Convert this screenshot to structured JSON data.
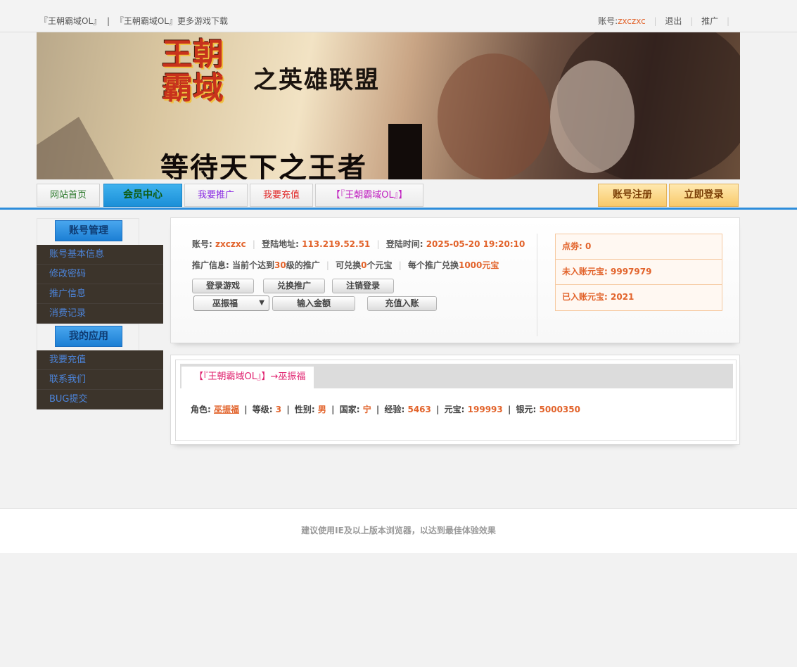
{
  "topbar": {
    "links": [
      "『王朝霸域OL』",
      "|",
      "『王朝霸域OL』更多游戏下载"
    ],
    "account_label": "账号:",
    "account_value": "zxczxc",
    "logout": "退出",
    "promote": "推广"
  },
  "banner": {
    "logo": "王朝霸域",
    "slogan": "之英雄联盟",
    "tagline": "等待天下之王者"
  },
  "nav": {
    "home": "网站首页",
    "member": "会员中心",
    "promote": "我要推广",
    "recharge": "我要充值",
    "game": "【『王朝霸域OL』】",
    "register": "账号注册",
    "login": "立即登录"
  },
  "sidebar": {
    "account_title": "账号管理",
    "account_items": [
      "账号基本信息",
      "修改密码",
      "推广信息",
      "消费记录"
    ],
    "apps_title": "我的应用",
    "app_items": [
      "我要充值",
      "联系我们",
      "BUG提交"
    ]
  },
  "account_panel": {
    "account_label": "账号:",
    "account_value": "zxczxc",
    "ip_label": "登陆地址:",
    "ip_value": "113.219.52.51",
    "time_label": "登陆时间:",
    "time_value": "2025-05-20 19:20:10",
    "promo_label": "推广信息:",
    "promo_text1": "当前个达到",
    "promo_level": "30",
    "promo_text2": "级的推广",
    "promo_text3": "可兑换",
    "promo_count": "0",
    "promo_text4": "个元宝",
    "promo_text5": "每个推广兑换",
    "promo_rate": "1000元宝",
    "buttons": {
      "login_game": "登录游戏",
      "redeem": "兑换推广",
      "logout": "注销登录",
      "amount": "输入金额",
      "recharge": "充值入账"
    },
    "role_select": "巫振福"
  },
  "stats": {
    "points_label": "点劵:",
    "points_value": "0",
    "pending_label": "未入账元宝:",
    "pending_value": "9997979",
    "credited_label": "已入账元宝:",
    "credited_value": "2021"
  },
  "character": {
    "tab": "【『王朝霸域OL』】→巫振福",
    "role_label": "角色:",
    "role_value": "巫振福",
    "level_label": "等级:",
    "level_value": "3",
    "gender_label": "性别:",
    "gender_value": "男",
    "country_label": "国家:",
    "country_value": "宁",
    "exp_label": "经验:",
    "exp_value": "5463",
    "yuanbao_label": "元宝:",
    "yuanbao_value": "199993",
    "silver_label": "银元:",
    "silver_value": "5000350"
  },
  "footer": {
    "text": "建议使用IE及以上版本浏览器，以达到最佳体验效果"
  },
  "colors": {
    "accent_blue": "#2d8ddb",
    "orange": "#e2632b",
    "sidebar_bg": "#3c342b",
    "sidebar_link": "#4c84d9",
    "pink": "#e0206e"
  }
}
